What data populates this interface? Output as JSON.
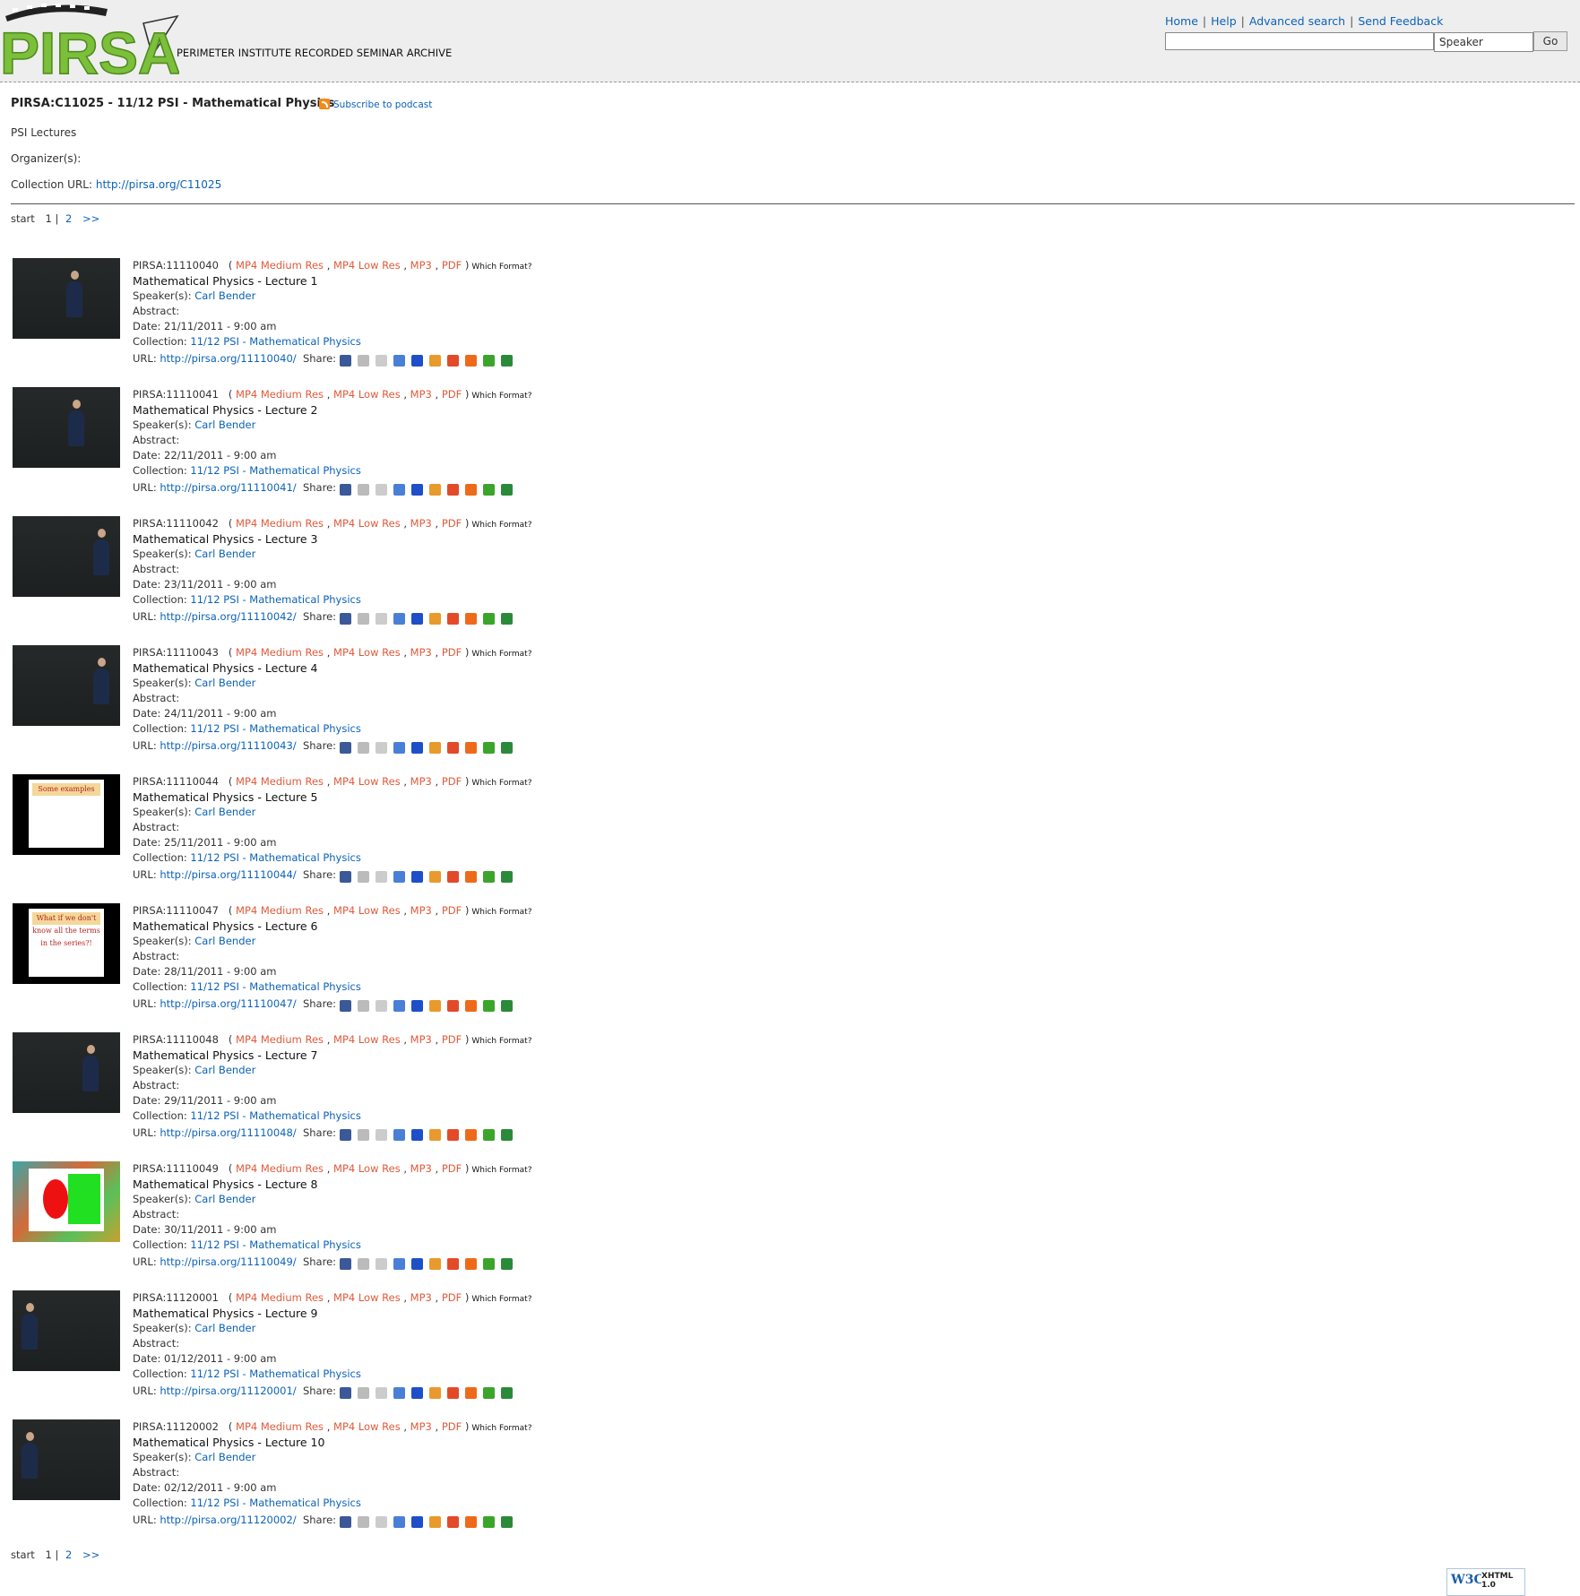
{
  "header": {
    "logo_text": "PIRSA",
    "tagline": "PERIMETER INSTITUTE RECORDED SEMINAR ARCHIVE",
    "links": [
      "Home",
      "Help",
      "Advanced search",
      "Send Feedback"
    ],
    "search_value": "",
    "search_select": "Speaker",
    "go_label": "Go"
  },
  "collection": {
    "title": "PIRSA:C11025 - 11/12 PSI - Mathematical Physics",
    "podcast_label": "Subscribe to podcast",
    "category": "PSI Lectures",
    "organizer_label": "Organizer(s):",
    "url_label": "Collection URL:",
    "url": "http://pirsa.org/C11025"
  },
  "pager": {
    "start": "start",
    "current": "1",
    "sep": "|",
    "next_page": "2",
    "next": ">>"
  },
  "labels": {
    "open_paren": "(",
    "close_paren": ")",
    "comma": ",",
    "formats": [
      "MP4 Medium Res",
      "MP4 Low Res",
      "MP3",
      "PDF"
    ],
    "which_format": "Which Format?",
    "speakers": "Speaker(s):",
    "abstract": "Abstract:",
    "date": "Date:",
    "collection": "Collection:",
    "url": "URL:",
    "share": "Share:"
  },
  "lectures": [
    {
      "id": "PIRSA:11110040",
      "title": "Mathematical Physics - Lecture 1",
      "speaker": "Carl Bender",
      "date": "21/11/2011 - 9:00 am",
      "collection": "11/12 PSI - Mathematical Physics",
      "url": "http://pirsa.org/11110040/",
      "thumb": "board"
    },
    {
      "id": "PIRSA:11110041",
      "title": "Mathematical Physics - Lecture 2",
      "speaker": "Carl Bender",
      "date": "22/11/2011 - 9:00 am",
      "collection": "11/12 PSI - Mathematical Physics",
      "url": "http://pirsa.org/11110041/",
      "thumb": "board"
    },
    {
      "id": "PIRSA:11110042",
      "title": "Mathematical Physics - Lecture 3",
      "speaker": "Carl Bender",
      "date": "23/11/2011 - 9:00 am",
      "collection": "11/12 PSI - Mathematical Physics",
      "url": "http://pirsa.org/11110042/",
      "thumb": "board"
    },
    {
      "id": "PIRSA:11110043",
      "title": "Mathematical Physics - Lecture 4",
      "speaker": "Carl Bender",
      "date": "24/11/2011 - 9:00 am",
      "collection": "11/12 PSI - Mathematical Physics",
      "url": "http://pirsa.org/11110043/",
      "thumb": "board"
    },
    {
      "id": "PIRSA:11110044",
      "title": "Mathematical Physics - Lecture 5",
      "speaker": "Carl Bender",
      "date": "25/11/2011 - 9:00 am",
      "collection": "11/12 PSI - Mathematical Physics",
      "url": "http://pirsa.org/11110044/",
      "thumb": "slide",
      "slide_text": "Some examples"
    },
    {
      "id": "PIRSA:11110047",
      "title": "Mathematical Physics - Lecture 6",
      "speaker": "Carl Bender",
      "date": "28/11/2011 - 9:00 am",
      "collection": "11/12 PSI - Mathematical Physics",
      "url": "http://pirsa.org/11110047/",
      "thumb": "slide",
      "slide_text": "What if we don't know all the terms in the series?!"
    },
    {
      "id": "PIRSA:11110048",
      "title": "Mathematical Physics - Lecture 7",
      "speaker": "Carl Bender",
      "date": "29/11/2011 - 9:00 am",
      "collection": "11/12 PSI - Mathematical Physics",
      "url": "http://pirsa.org/11110048/",
      "thumb": "board"
    },
    {
      "id": "PIRSA:11110049",
      "title": "Mathematical Physics - Lecture 8",
      "speaker": "Carl Bender",
      "date": "30/11/2011 - 9:00 am",
      "collection": "11/12 PSI - Mathematical Physics",
      "url": "http://pirsa.org/11110049/",
      "thumb": "fractal"
    },
    {
      "id": "PIRSA:11120001",
      "title": "Mathematical Physics - Lecture 9",
      "speaker": "Carl Bender",
      "date": "01/12/2011 - 9:00 am",
      "collection": "11/12 PSI - Mathematical Physics",
      "url": "http://pirsa.org/11120001/",
      "thumb": "board"
    },
    {
      "id": "PIRSA:11120002",
      "title": "Mathematical Physics - Lecture 10",
      "speaker": "Carl Bender",
      "date": "02/12/2011 - 9:00 am",
      "collection": "11/12 PSI - Mathematical Physics",
      "url": "http://pirsa.org/11120002/",
      "thumb": "board"
    }
  ],
  "share_icons": [
    {
      "name": "facebook-icon",
      "color": "#3b5998"
    },
    {
      "name": "digg-icon",
      "color": "#bbbbbb"
    },
    {
      "name": "reddit-icon",
      "color": "#cccccc"
    },
    {
      "name": "google-icon",
      "color": "#4a7fd6"
    },
    {
      "name": "delicious-icon",
      "color": "#1e4fc9"
    },
    {
      "name": "windows-live-icon",
      "color": "#e89a2c"
    },
    {
      "name": "yahoo-icon",
      "color": "#e24a2a"
    },
    {
      "name": "furl-icon",
      "color": "#ee6a1a"
    },
    {
      "name": "stumbleupon-icon",
      "color": "#3aa52a"
    },
    {
      "name": "ma-gnolia-icon",
      "color": "#2a8a3a"
    }
  ],
  "badge": {
    "w3c": "W3C",
    "xhtml": "XHTML 1.0"
  }
}
